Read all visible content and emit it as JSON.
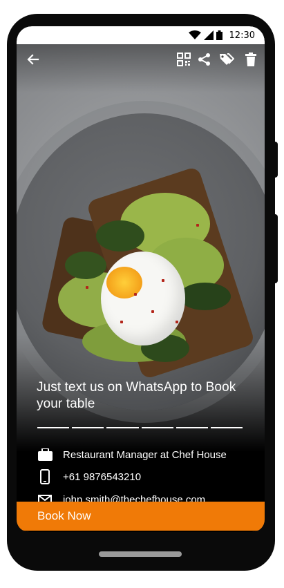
{
  "status_bar": {
    "time": "12:30"
  },
  "toolbar": {
    "back_icon": "arrow-left-icon",
    "qr_icon": "qr-code-icon",
    "share_icon": "share-icon",
    "tag_icon": "tags-icon",
    "delete_icon": "trash-icon"
  },
  "card": {
    "headline": "Just text us on WhatsApp to Book your table",
    "story_segments": 6,
    "job_title": "Restaurant Manager at Chef House",
    "phone": "+61 9876543210",
    "email": "john.smith@thechefhouse.com"
  },
  "cta": {
    "label": "Book Now"
  },
  "colors": {
    "accent": "#f07a07",
    "frame": "#0a0a0a",
    "text_on_dark": "#ffffff"
  }
}
